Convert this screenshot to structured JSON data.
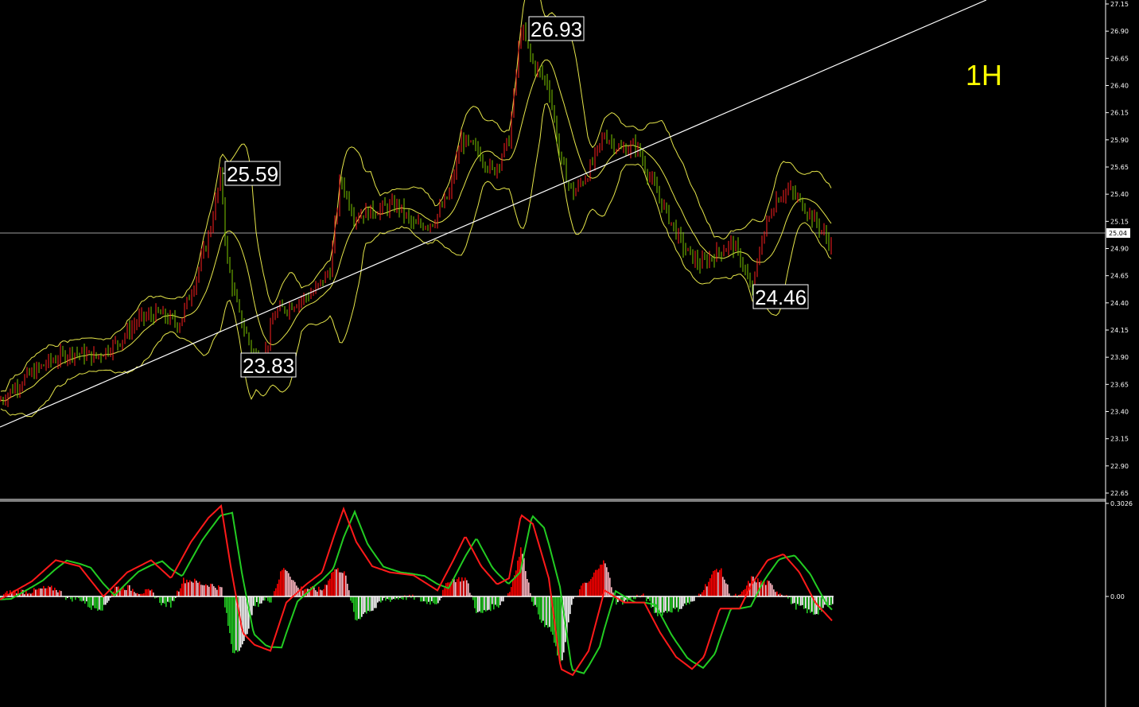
{
  "timeframe_label": "1H",
  "price_scale": {
    "ticks": [
      "27.15",
      "26.90",
      "26.65",
      "26.40",
      "26.15",
      "25.90",
      "25.65",
      "25.40",
      "25.15",
      "24.90",
      "24.65",
      "24.40",
      "24.15",
      "23.90",
      "23.65",
      "23.40",
      "23.15",
      "22.90",
      "22.65"
    ],
    "current_price": "25.04"
  },
  "osc_scale": {
    "ticks": [
      "0.3026",
      "0.00"
    ]
  },
  "annotations": [
    {
      "text": "25.59"
    },
    {
      "text": "23.83"
    },
    {
      "text": "26.93"
    },
    {
      "text": "24.46"
    }
  ],
  "colors": {
    "background": "#000000",
    "bull": "#ff2020",
    "bear": "#7ec800",
    "bands": "#e6e64a",
    "trendline": "#ffffff",
    "macd": "#ff1a1a",
    "signal": "#22cc22",
    "hist_pos_rising": "#ff0000",
    "hist_pos_falling": "#ffb6c1",
    "hist_neg_falling": "#22cc22",
    "hist_neg_rising": "#ffffff"
  },
  "chart_data": {
    "type": "line",
    "title": "",
    "ylim": [
      22.65,
      27.15
    ],
    "price_path": [
      [
        0,
        23.5
      ],
      [
        30,
        23.7
      ],
      [
        60,
        23.85
      ],
      [
        90,
        23.95
      ],
      [
        120,
        23.9
      ],
      [
        150,
        24.05
      ],
      [
        175,
        24.25
      ],
      [
        200,
        24.3
      ],
      [
        225,
        24.2
      ],
      [
        245,
        24.6
      ],
      [
        262,
        25.0
      ],
      [
        278,
        25.59
      ],
      [
        285,
        24.8
      ],
      [
        300,
        24.3
      ],
      [
        318,
        23.95
      ],
      [
        330,
        23.83
      ],
      [
        345,
        24.3
      ],
      [
        370,
        24.4
      ],
      [
        395,
        24.5
      ],
      [
        415,
        24.7
      ],
      [
        428,
        25.55
      ],
      [
        445,
        25.2
      ],
      [
        470,
        25.25
      ],
      [
        500,
        25.3
      ],
      [
        520,
        25.1
      ],
      [
        545,
        25.15
      ],
      [
        565,
        25.4
      ],
      [
        580,
        25.9
      ],
      [
        600,
        25.8
      ],
      [
        620,
        25.6
      ],
      [
        640,
        25.9
      ],
      [
        655,
        26.93
      ],
      [
        670,
        26.6
      ],
      [
        690,
        26.4
      ],
      [
        705,
        25.7
      ],
      [
        720,
        25.4
      ],
      [
        740,
        25.6
      ],
      [
        760,
        25.95
      ],
      [
        780,
        25.8
      ],
      [
        800,
        25.85
      ],
      [
        820,
        25.5
      ],
      [
        840,
        25.2
      ],
      [
        860,
        24.9
      ],
      [
        880,
        24.75
      ],
      [
        900,
        24.85
      ],
      [
        920,
        24.95
      ],
      [
        935,
        24.75
      ],
      [
        945,
        24.46
      ],
      [
        958,
        25.0
      ],
      [
        975,
        25.35
      ],
      [
        990,
        25.45
      ],
      [
        1010,
        25.3
      ],
      [
        1030,
        25.1
      ],
      [
        1046,
        24.92
      ]
    ],
    "oscillator_path": [
      [
        0,
        -0.01
      ],
      [
        40,
        0.05
      ],
      [
        70,
        0.12
      ],
      [
        100,
        0.1
      ],
      [
        130,
        0.0
      ],
      [
        160,
        0.08
      ],
      [
        190,
        0.12
      ],
      [
        215,
        0.06
      ],
      [
        240,
        0.18
      ],
      [
        262,
        0.26
      ],
      [
        278,
        0.3
      ],
      [
        290,
        0.1
      ],
      [
        305,
        -0.12
      ],
      [
        320,
        -0.16
      ],
      [
        340,
        -0.18
      ],
      [
        360,
        -0.02
      ],
      [
        385,
        0.04
      ],
      [
        405,
        0.08
      ],
      [
        420,
        0.2
      ],
      [
        432,
        0.29
      ],
      [
        448,
        0.18
      ],
      [
        468,
        0.1
      ],
      [
        490,
        0.08
      ],
      [
        520,
        0.07
      ],
      [
        550,
        0.02
      ],
      [
        570,
        0.12
      ],
      [
        585,
        0.2
      ],
      [
        605,
        0.1
      ],
      [
        625,
        0.04
      ],
      [
        640,
        0.06
      ],
      [
        655,
        0.27
      ],
      [
        670,
        0.24
      ],
      [
        690,
        0.06
      ],
      [
        705,
        -0.24
      ],
      [
        720,
        -0.26
      ],
      [
        740,
        -0.18
      ],
      [
        760,
        0.02
      ],
      [
        785,
        -0.02
      ],
      [
        810,
        -0.02
      ],
      [
        830,
        -0.12
      ],
      [
        850,
        -0.2
      ],
      [
        870,
        -0.24
      ],
      [
        885,
        -0.2
      ],
      [
        905,
        -0.04
      ],
      [
        930,
        -0.04
      ],
      [
        945,
        0.04
      ],
      [
        965,
        0.12
      ],
      [
        985,
        0.14
      ],
      [
        1005,
        0.08
      ],
      [
        1025,
        -0.02
      ],
      [
        1046,
        -0.08
      ]
    ]
  }
}
